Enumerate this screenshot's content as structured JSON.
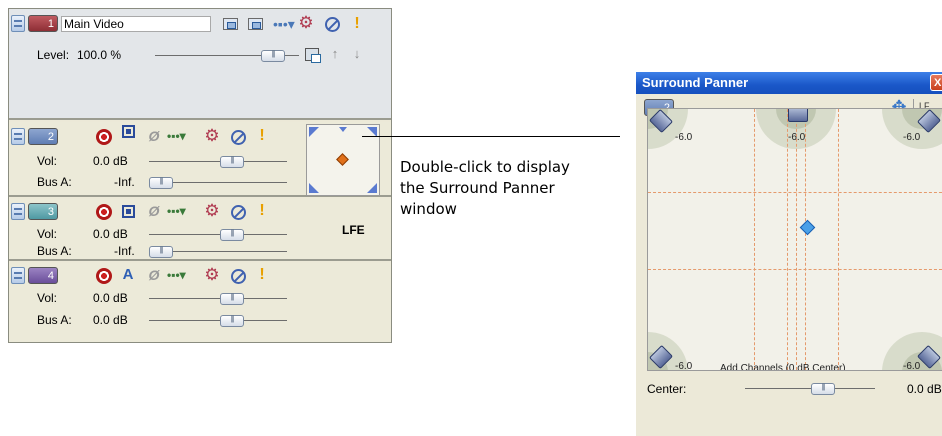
{
  "video_track": {
    "number": "1",
    "name": "Main Video",
    "level_label": "Level:",
    "level_value": "100.0 %",
    "level_fraction": 0.88
  },
  "audio_tracks": [
    {
      "number": "2",
      "vol_label": "Vol:",
      "vol_value": "0.0 dB",
      "bus_label": "Bus A:",
      "bus_value": "-Inf.",
      "vol_fraction": 0.62,
      "bus_fraction": 0.0
    },
    {
      "number": "3",
      "vol_label": "Vol:",
      "vol_value": "0.0 dB",
      "bus_label": "Bus A:",
      "bus_value": "-Inf.",
      "vol_fraction": 0.62,
      "bus_fraction": 0.0,
      "lfe": "LFE"
    },
    {
      "number": "4",
      "vol_label": "Vol:",
      "vol_value": "0.0 dB",
      "bus_label": "Bus A:",
      "bus_value": "0.0 dB",
      "vol_fraction": 0.62,
      "bus_fraction": 0.62
    }
  ],
  "callout": {
    "line1": "Double-click to display",
    "line2": "the Surround Panner",
    "line3": "window"
  },
  "surround_panner": {
    "title": "Surround Panner",
    "close_glyph": "X",
    "track_number": "2",
    "lfe_label": "LF",
    "speaker_levels": {
      "front_left": "-6.0",
      "center": "-6.0",
      "front_right": "-6.0",
      "rear_left": "-6.0",
      "rear_right": "-6.0"
    },
    "add_channels_label": "Add Channels (0 dB Center)",
    "center_label": "Center:",
    "center_value": "0.0 dB",
    "center_fraction": 0.62
  },
  "icons": {
    "move_icon": "✥",
    "solo_icon": "!",
    "gear_icon": "⚙",
    "letter_a": "A",
    "phase_icon": "Ø",
    "fx_chain_icon": "•▪•▾",
    "up_arrow": "↑",
    "down_arrow": "↓"
  },
  "colors": {
    "titlebar": "#1a57c8",
    "video_track": "#8e2e35",
    "track2": "#5f7db3",
    "track3": "#4f99a2",
    "track4": "#6a4e9a",
    "grid": "#e59a6c",
    "pan_point": "#4aa0e8"
  }
}
